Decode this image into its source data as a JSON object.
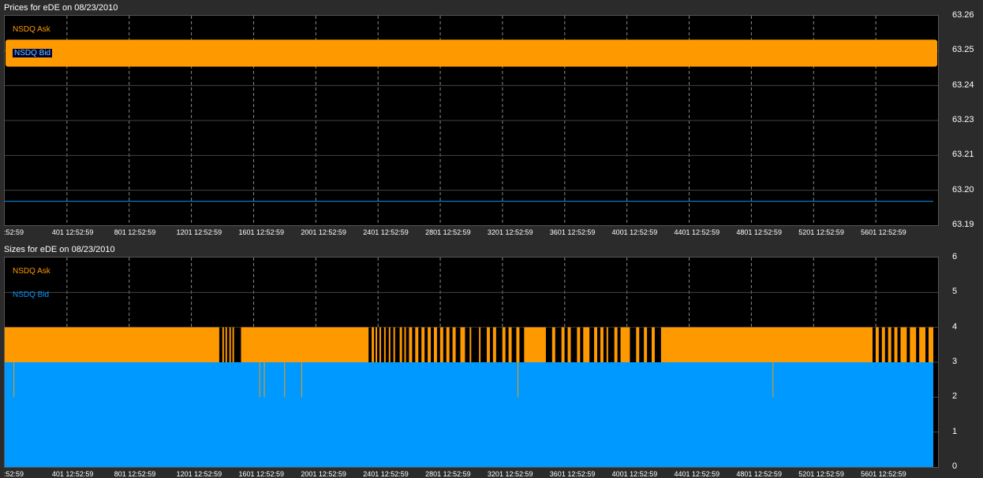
{
  "colors": {
    "ask": "#ff9900",
    "bid": "#0099ff",
    "grid": "#444444",
    "vgrid": "#888888"
  },
  "top": {
    "title": "Prices for  eDE  on  08/23/2010",
    "legend_ask": "NSDQ Ask",
    "legend_bid": "NSDQ Bid"
  },
  "bottom": {
    "title": "Sizes for  eDE  on  08/23/2010",
    "legend_ask": "NSDQ Ask",
    "legend_bid": "NSDQ Bid"
  },
  "chart_data": [
    {
      "type": "line",
      "title": "Prices for  eDE  on  08/23/2010",
      "x_ticks": [
        ":52:59",
        "401 12:52:59",
        "801 12:52:59",
        "1201 12:52:59",
        "1601 12:52:59",
        "2001 12:52:59",
        "2401 12:52:59",
        "2801 12:52:59",
        "3201 12:52:59",
        "3601 12:52:59",
        "4001 12:52:59",
        "4401 12:52:59",
        "4801 12:52:59",
        "5201 12:52:59",
        "5601 12:52:59"
      ],
      "y_ticks": [
        "63.26",
        "63.25",
        "63.24",
        "63.23",
        "63.21",
        "63.20",
        "63.19"
      ],
      "xlim": [
        1,
        6001
      ],
      "ylim": [
        63.19,
        63.26
      ],
      "series": [
        {
          "name": "NSDQ Ask",
          "range": [
            63.243,
            63.252
          ]
        },
        {
          "name": "NSDQ Bid",
          "value": 63.198
        }
      ],
      "grid": true
    },
    {
      "type": "area",
      "title": "Sizes for  eDE  on  08/23/2010",
      "x_ticks": [
        ":52:59",
        "401 12:52:59",
        "801 12:52:59",
        "1201 12:52:59",
        "1601 12:52:59",
        "2001 12:52:59",
        "2401 12:52:59",
        "2801 12:52:59",
        "3201 12:52:59",
        "3601 12:52:59",
        "4001 12:52:59",
        "4401 12:52:59",
        "4801 12:52:59",
        "5201 12:52:59",
        "5601 12:52:59"
      ],
      "y_ticks": [
        "6",
        "5",
        "4",
        "3",
        "2",
        "1",
        "0"
      ],
      "xlim": [
        1,
        6001
      ],
      "ylim": [
        0,
        6
      ],
      "series": [
        {
          "name": "NSDQ Ask",
          "value": 4,
          "gaps": [
            [
              1380,
              1400
            ],
            [
              1410,
              1420
            ],
            [
              1430,
              1445
            ],
            [
              1455,
              1465
            ],
            [
              1475,
              1520
            ],
            [
              2340,
              2360
            ],
            [
              2375,
              2385
            ],
            [
              2395,
              2410
            ],
            [
              2420,
              2440
            ],
            [
              2450,
              2470
            ],
            [
              2480,
              2500
            ],
            [
              2510,
              2540
            ],
            [
              2555,
              2570
            ],
            [
              2580,
              2600
            ],
            [
              2620,
              2640
            ],
            [
              2660,
              2680
            ],
            [
              2700,
              2720
            ],
            [
              2740,
              2760
            ],
            [
              2780,
              2800
            ],
            [
              2820,
              2840
            ],
            [
              2860,
              2880
            ],
            [
              2900,
              2930
            ],
            [
              2960,
              2990
            ],
            [
              3000,
              3050
            ],
            [
              3060,
              3100
            ],
            [
              3120,
              3140
            ],
            [
              3160,
              3200
            ],
            [
              3220,
              3240
            ],
            [
              3260,
              3290
            ],
            [
              3310,
              3340
            ],
            [
              3480,
              3520
            ],
            [
              3540,
              3580
            ],
            [
              3600,
              3620
            ],
            [
              3640,
              3680
            ],
            [
              3700,
              3720
            ],
            [
              3760,
              3790
            ],
            [
              3810,
              3830
            ],
            [
              3850,
              3870
            ],
            [
              3880,
              3920
            ],
            [
              3940,
              3960
            ],
            [
              4020,
              4060
            ],
            [
              4080,
              4110
            ],
            [
              4130,
              4160
            ],
            [
              4180,
              4220
            ],
            [
              5580,
              5600
            ],
            [
              5620,
              5640
            ],
            [
              5660,
              5680
            ],
            [
              5700,
              5720
            ],
            [
              5740,
              5760
            ],
            [
              5800,
              5820
            ],
            [
              5860,
              5880
            ],
            [
              5920,
              5940
            ]
          ]
        },
        {
          "name": "NSDQ Bid",
          "value": 3,
          "spikes": [
            60,
            1640,
            1670,
            1800,
            1910,
            3300,
            4940
          ]
        }
      ],
      "grid": true
    }
  ]
}
